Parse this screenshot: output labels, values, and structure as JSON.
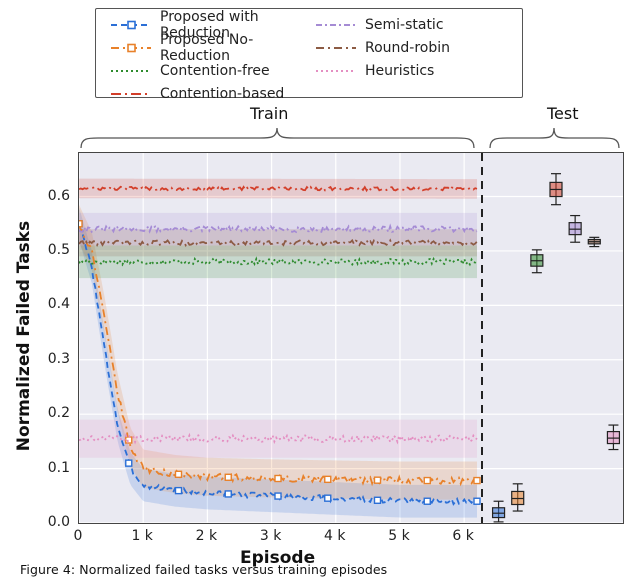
{
  "chart_data": {
    "type": "line",
    "title": "",
    "xlabel": "Episode",
    "ylabel": "Normalized Failed Tasks",
    "ylim": [
      0,
      0.68
    ],
    "x_ticks": [
      0,
      1000,
      2000,
      3000,
      4000,
      5000,
      6000
    ],
    "x_tick_labels": [
      "0",
      "1 k",
      "2 k",
      "3 k",
      "4 k",
      "5 k",
      "6 k"
    ],
    "y_ticks": [
      0.0,
      0.1,
      0.2,
      0.3,
      0.4,
      0.5,
      0.6
    ],
    "sections": {
      "train": {
        "label": "Train",
        "x_range": [
          0,
          6200
        ]
      },
      "test": {
        "label": "Test"
      }
    },
    "colors": {
      "proposed_reduction": "#2b6fd6",
      "proposed_noreduction": "#e8812a",
      "contention_free": "#2e8b2e",
      "contention_based": "#d33f2a",
      "semi_static": "#a58bd4",
      "round_robin": "#8c5b44",
      "heuristics": "#e48fc2"
    },
    "series": [
      {
        "name": "Proposed with Reduction",
        "key": "proposed_reduction",
        "x_anchor": [
          0,
          200,
          400,
          600,
          800,
          1000,
          1500,
          2000,
          3000,
          4000,
          5000,
          6200
        ],
        "y_anchor": [
          0.55,
          0.47,
          0.32,
          0.18,
          0.1,
          0.07,
          0.06,
          0.055,
          0.05,
          0.045,
          0.04,
          0.04
        ],
        "band": 0.03,
        "dash": "6 4",
        "marker": "square"
      },
      {
        "name": "Proposed No-Reduction",
        "key": "proposed_noreduction",
        "x_anchor": [
          0,
          200,
          400,
          600,
          800,
          1000,
          1500,
          2000,
          3000,
          4000,
          5000,
          6200
        ],
        "y_anchor": [
          0.55,
          0.5,
          0.38,
          0.24,
          0.14,
          0.1,
          0.09,
          0.085,
          0.082,
          0.08,
          0.078,
          0.078
        ],
        "band": 0.035,
        "dash": "8 4 2 4",
        "marker": "square"
      },
      {
        "name": "Contention-free",
        "key": "contention_free",
        "x_anchor": [
          0,
          6200
        ],
        "y_anchor": [
          0.48,
          0.48
        ],
        "band": 0.03,
        "dash": "2 3"
      },
      {
        "name": "Contention-based",
        "key": "contention_based",
        "x_anchor": [
          0,
          6200
        ],
        "y_anchor": [
          0.615,
          0.614
        ],
        "band": 0.018,
        "dash": "10 4 2 4"
      },
      {
        "name": "Semi-static",
        "key": "semi_static",
        "x_anchor": [
          0,
          6200
        ],
        "y_anchor": [
          0.54,
          0.54
        ],
        "band": 0.03,
        "dash": "6 3 2 3"
      },
      {
        "name": "Round-robin",
        "key": "round_robin",
        "x_anchor": [
          0,
          6200
        ],
        "y_anchor": [
          0.515,
          0.515
        ],
        "band": 0.025,
        "dash": "8 4 2 4"
      },
      {
        "name": "Heuristics",
        "key": "heuristics",
        "x_anchor": [
          0,
          6200
        ],
        "y_anchor": [
          0.155,
          0.155
        ],
        "band": 0.035,
        "dash": "2 3"
      }
    ],
    "test_points": [
      {
        "key": "proposed_reduction",
        "slot": 0,
        "median": 0.018,
        "q1": 0.01,
        "q3": 0.028,
        "lo": 0.002,
        "hi": 0.04
      },
      {
        "key": "proposed_noreduction",
        "slot": 1,
        "median": 0.045,
        "q1": 0.034,
        "q3": 0.058,
        "lo": 0.022,
        "hi": 0.072
      },
      {
        "key": "contention_free",
        "slot": 2,
        "median": 0.482,
        "q1": 0.472,
        "q3": 0.493,
        "lo": 0.46,
        "hi": 0.502
      },
      {
        "key": "contention_based",
        "slot": 3,
        "median": 0.613,
        "q1": 0.6,
        "q3": 0.626,
        "lo": 0.585,
        "hi": 0.642
      },
      {
        "key": "semi_static",
        "slot": 4,
        "median": 0.54,
        "q1": 0.53,
        "q3": 0.552,
        "lo": 0.516,
        "hi": 0.565
      },
      {
        "key": "round_robin",
        "slot": 5,
        "median": 0.517,
        "q1": 0.513,
        "q3": 0.521,
        "lo": 0.508,
        "hi": 0.525
      },
      {
        "key": "heuristics",
        "slot": 6,
        "median": 0.156,
        "q1": 0.146,
        "q3": 0.168,
        "lo": 0.135,
        "hi": 0.18
      }
    ]
  },
  "legend": {
    "col1": [
      {
        "key": "proposed_reduction",
        "label": "Proposed with Reduction"
      },
      {
        "key": "proposed_noreduction",
        "label": "Proposed No-Reduction"
      },
      {
        "key": "contention_free",
        "label": "Contention-free"
      },
      {
        "key": "contention_based",
        "label": "Contention-based"
      }
    ],
    "col2": [
      {
        "key": "semi_static",
        "label": "Semi-static"
      },
      {
        "key": "round_robin",
        "label": "Round-robin"
      },
      {
        "key": "heuristics",
        "label": "Heuristics"
      }
    ]
  },
  "caption": "Figure 4: Normalized failed tasks versus training episodes"
}
